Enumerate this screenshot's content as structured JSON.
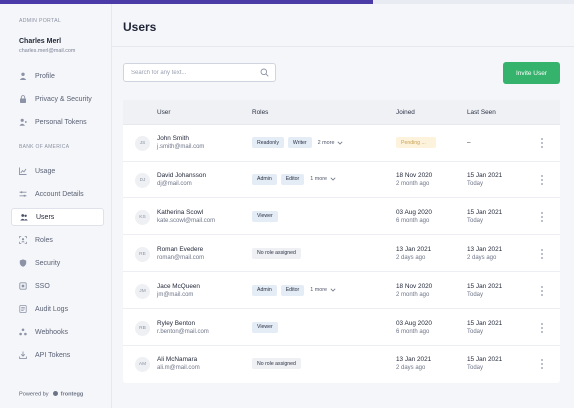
{
  "sidebar": {
    "portal_label": "ADMIN PORTAL",
    "user_name": "Charles Merl",
    "user_email": "charles.merl@mail.com",
    "top_items": [
      {
        "label": "Profile",
        "icon": "person-icon"
      },
      {
        "label": "Privacy & Security",
        "icon": "lock-icon"
      },
      {
        "label": "Personal Tokens",
        "icon": "user-key-icon"
      }
    ],
    "section_label": "BANK OF AMERICA",
    "items": [
      {
        "label": "Usage",
        "icon": "chart-icon"
      },
      {
        "label": "Account Details",
        "icon": "sliders-icon"
      },
      {
        "label": "Users",
        "icon": "users-icon",
        "active": true
      },
      {
        "label": "Roles",
        "icon": "roles-icon"
      },
      {
        "label": "Security",
        "icon": "shield-icon"
      },
      {
        "label": "SSO",
        "icon": "sso-icon"
      },
      {
        "label": "Audit Logs",
        "icon": "list-icon"
      },
      {
        "label": "Webhooks",
        "icon": "webhook-icon"
      },
      {
        "label": "API Tokens",
        "icon": "download-icon"
      }
    ],
    "powered_prefix": "Powered by",
    "powered_brand": "frontegg"
  },
  "main": {
    "title": "Users",
    "search_placeholder": "Search for any text...",
    "invite_label": "Invite User",
    "columns": {
      "user": "User",
      "roles": "Roles",
      "joined": "Joined",
      "last_seen": "Last Seen"
    },
    "rows": [
      {
        "initials": "JS",
        "name": "John Smith",
        "email": "j.smith@mail.com",
        "roles": [
          "Readonly",
          "Writer"
        ],
        "more": "2 more",
        "pending": "Pending ...",
        "joined": "",
        "joined_ago": "",
        "last_seen": "–",
        "last_seen_ago": ""
      },
      {
        "initials": "DJ",
        "name": "David Johansson",
        "email": "dj@mail.com",
        "roles": [
          "Admin",
          "Editor"
        ],
        "more": "1 more",
        "pending": "",
        "joined": "18 Nov 2020",
        "joined_ago": "2 month ago",
        "last_seen": "15 Jan 2021",
        "last_seen_ago": "Today"
      },
      {
        "initials": "KS",
        "name": "Katherina Scowl",
        "email": "kate.scowl@mail.com",
        "roles": [
          "Viewer"
        ],
        "more": "",
        "pending": "",
        "joined": "03 Aug 2020",
        "joined_ago": "6 month ago",
        "last_seen": "15 Jan 2021",
        "last_seen_ago": "Today"
      },
      {
        "initials": "RE",
        "name": "Roman Evedere",
        "email": "roman@mail.com",
        "roles": [],
        "no_role": "No role assigned",
        "more": "",
        "pending": "",
        "joined": "13 Jan 2021",
        "joined_ago": "2 days ago",
        "last_seen": "13 Jan 2021",
        "last_seen_ago": "2 days ago"
      },
      {
        "initials": "JM",
        "name": "Jace McQueen",
        "email": "jm@mail.com",
        "roles": [
          "Admin",
          "Editor"
        ],
        "more": "1 more",
        "pending": "",
        "joined": "18 Nov 2020",
        "joined_ago": "2 month ago",
        "last_seen": "15 Jan 2021",
        "last_seen_ago": "Today"
      },
      {
        "initials": "RB",
        "name": "Ryley Benton",
        "email": "r.benton@mail.com",
        "roles": [
          "Viewer"
        ],
        "more": "",
        "pending": "",
        "joined": "03 Aug 2020",
        "joined_ago": "6 month ago",
        "last_seen": "15 Jan 2021",
        "last_seen_ago": "Today"
      },
      {
        "initials": "AM",
        "name": "Ali McNamara",
        "email": "ali.m@mail.com",
        "roles": [],
        "no_role": "No role assigned",
        "more": "",
        "pending": "",
        "joined": "13 Jan 2021",
        "joined_ago": "2 days ago",
        "last_seen": "15 Jan 2021",
        "last_seen_ago": "Today"
      }
    ]
  },
  "colors": {
    "accent": "#35b26b",
    "topbar": "#4b3ba8",
    "pending_bg": "#fdf3dc",
    "role_chip": "#e4ecf6"
  }
}
